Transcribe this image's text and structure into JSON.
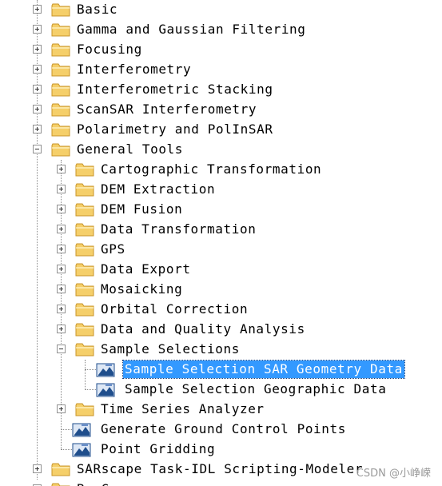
{
  "tree": {
    "items": [
      {
        "label": "Basic",
        "level": 0,
        "type": "folder",
        "state": "collapsed"
      },
      {
        "label": "Gamma and Gaussian Filtering",
        "level": 0,
        "type": "folder",
        "state": "collapsed"
      },
      {
        "label": "Focusing",
        "level": 0,
        "type": "folder",
        "state": "collapsed"
      },
      {
        "label": "Interferometry",
        "level": 0,
        "type": "folder",
        "state": "collapsed"
      },
      {
        "label": "Interferometric Stacking",
        "level": 0,
        "type": "folder",
        "state": "collapsed"
      },
      {
        "label": "ScanSAR Interferometry",
        "level": 0,
        "type": "folder",
        "state": "collapsed"
      },
      {
        "label": "Polarimetry and PolInSAR",
        "level": 0,
        "type": "folder",
        "state": "collapsed"
      },
      {
        "label": "General Tools",
        "level": 0,
        "type": "folder",
        "state": "expanded"
      },
      {
        "label": "Cartographic Transformation",
        "level": 1,
        "type": "folder",
        "state": "collapsed"
      },
      {
        "label": "DEM Extraction",
        "level": 1,
        "type": "folder",
        "state": "collapsed"
      },
      {
        "label": "DEM Fusion",
        "level": 1,
        "type": "folder",
        "state": "collapsed"
      },
      {
        "label": "Data Transformation",
        "level": 1,
        "type": "folder",
        "state": "collapsed"
      },
      {
        "label": "GPS",
        "level": 1,
        "type": "folder",
        "state": "collapsed"
      },
      {
        "label": "Data Export",
        "level": 1,
        "type": "folder",
        "state": "collapsed"
      },
      {
        "label": "Mosaicking",
        "level": 1,
        "type": "folder",
        "state": "collapsed"
      },
      {
        "label": "Orbital Correction",
        "level": 1,
        "type": "folder",
        "state": "collapsed"
      },
      {
        "label": "Data and Quality Analysis",
        "level": 1,
        "type": "folder",
        "state": "collapsed"
      },
      {
        "label": "Sample Selections",
        "level": 1,
        "type": "folder",
        "state": "expanded"
      },
      {
        "label": "Sample Selection SAR Geometry Data",
        "level": 2,
        "type": "tool",
        "selected": true
      },
      {
        "label": "Sample Selection Geographic Data",
        "level": 2,
        "type": "tool"
      },
      {
        "label": "Time Series Analyzer",
        "level": 1,
        "type": "folder",
        "state": "collapsed"
      },
      {
        "label": "Generate Ground Control Points",
        "level": 1,
        "type": "tool"
      },
      {
        "label": "Point Gridding",
        "level": 1,
        "type": "tool"
      },
      {
        "label": "SARscape Task-IDL Scripting-Modeler",
        "level": 0,
        "type": "folder",
        "state": "collapsed"
      },
      {
        "label": "Be_G...",
        "level": 0,
        "type": "folder",
        "state": "collapsed"
      }
    ]
  },
  "watermark": "CSDN @小峥嵘",
  "colors": {
    "selection": "#3399ff",
    "folder_fill": "#f5cf6a",
    "folder_edge": "#c9962a",
    "tool_icon": "#1f4e8c"
  },
  "icons": {
    "folder": "folder-icon",
    "tool": "tool-icon",
    "expand": "expand-icon",
    "collapse": "collapse-icon"
  }
}
